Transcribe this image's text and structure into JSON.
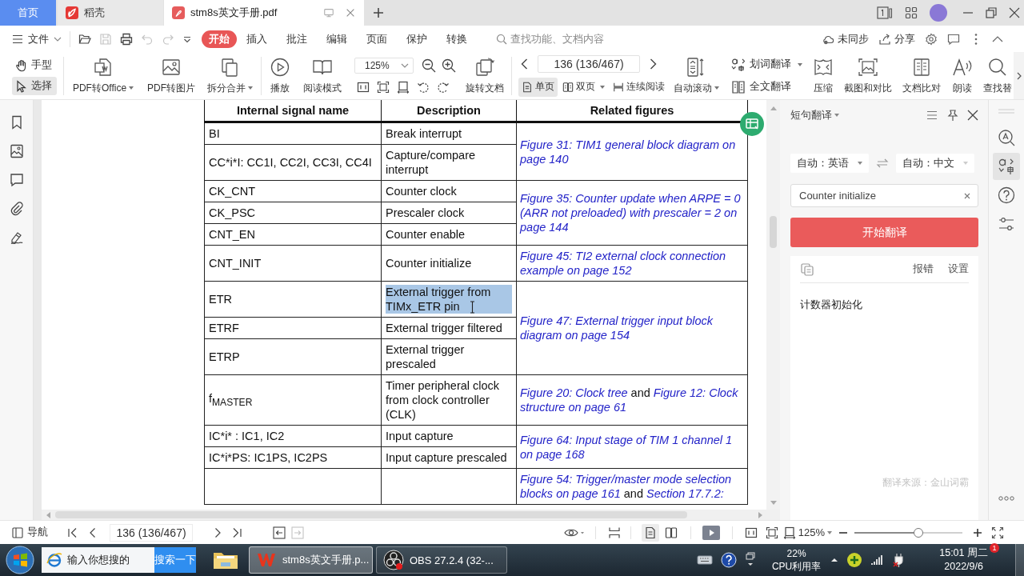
{
  "tabs": [
    {
      "kind": "home",
      "label": "首页",
      "selected": false
    },
    {
      "kind": "docer",
      "label": "稻壳",
      "selected": false
    },
    {
      "kind": "pdf",
      "label": "stm8s英文手册.pdf",
      "selected": true
    }
  ],
  "menu_bar": {
    "file_menu": "文件",
    "quick_access": [
      {
        "disabled": false
      },
      {
        "disabled": true
      },
      {
        "disabled": false
      },
      {
        "disabled": true
      },
      {
        "disabled": true
      }
    ],
    "items": [
      {
        "label": "开始",
        "selected": true
      },
      {
        "label": "插入",
        "selected": false
      },
      {
        "label": "批注",
        "selected": false
      },
      {
        "label": "编辑",
        "selected": false
      },
      {
        "label": "页面",
        "selected": false
      },
      {
        "label": "保护",
        "selected": false
      },
      {
        "label": "转换",
        "selected": false
      }
    ],
    "search": {
      "placeholder": "查找功能、文档内容"
    },
    "sync": "未同步",
    "share": "分享"
  },
  "toolbar": {
    "pointer_tools": [
      {
        "label": "手型",
        "selected": false
      },
      {
        "label": "选择",
        "selected": true
      }
    ],
    "actions": [
      {
        "label": "PDF转Office",
        "dropdown": true
      },
      {
        "label": "PDF转图片",
        "dropdown": false
      },
      {
        "label": "拆分合并",
        "dropdown": true
      },
      {
        "label": "播放",
        "dropdown": false
      },
      {
        "label": "阅读模式",
        "dropdown": false
      }
    ],
    "zoom": {
      "value": "125%"
    },
    "rotate": {
      "label": "旋转文档"
    },
    "page_field": {
      "value": "136 (136/467)"
    },
    "view_modes": [
      {
        "label": "单页",
        "selected": true,
        "dropdown": false
      },
      {
        "label": "双页",
        "selected": false,
        "dropdown": true
      },
      {
        "label": "连续阅读",
        "selected": false,
        "dropdown": false
      }
    ],
    "auto_scroll": {
      "label": "自动滚动",
      "dropdown": true
    },
    "translate": [
      {
        "label": "划词翻译",
        "dropdown": true
      },
      {
        "label": "全文翻译",
        "dropdown": false
      }
    ],
    "more_tools": [
      {
        "label": "压缩"
      },
      {
        "label": "截图和对比"
      },
      {
        "label": "文档比对"
      },
      {
        "label": "朗读"
      },
      {
        "label": "查找替"
      }
    ]
  },
  "document": {
    "table": {
      "columns": [
        "Internal signal name",
        "Description",
        "Related figures"
      ],
      "groups": [
        {
          "figure": {
            "kind": "link",
            "text": "Figure 31: TIM1 general block diagram on page 140"
          },
          "rows": [
            {
              "signal": "BI",
              "description": "Break interrupt",
              "highlighted": false
            },
            {
              "signal": "CC*i*I: CC1I, CC2I, CC3I, CC4I",
              "description": "Capture/compare interrupt",
              "highlighted": false
            }
          ]
        },
        {
          "figure": {
            "kind": "link",
            "text": "Figure 35: Counter update when ARPE = 0 (ARR not preloaded) with prescaler = 2 on page 144"
          },
          "rows": [
            {
              "signal": "CK_CNT",
              "description": "Counter clock",
              "highlighted": false
            },
            {
              "signal": "CK_PSC",
              "description": "Prescaler clock",
              "highlighted": false
            },
            {
              "signal": "CNT_EN",
              "description": "Counter enable",
              "highlighted": false
            }
          ]
        },
        {
          "figure": {
            "kind": "link",
            "text": "Figure 45: TI2 external clock connection example on page 152"
          },
          "rows": [
            {
              "signal": "CNT_INIT",
              "description": "Counter initialize",
              "highlighted": false
            }
          ]
        },
        {
          "figure": {
            "kind": "link",
            "text": "Figure 47: External trigger input block diagram on page 154"
          },
          "rows": [
            {
              "signal": "ETR",
              "description": "External trigger from TIMx_ETR pin",
              "highlighted": true
            },
            {
              "signal": "ETRF",
              "description": "External trigger filtered",
              "highlighted": false
            },
            {
              "signal": "ETRP",
              "description": "External trigger prescaled",
              "highlighted": false
            }
          ]
        },
        {
          "figure": {
            "kind": "mixed",
            "text": "*Figure 20: Clock tree* and *Figure 12: Clock structure on page 61*"
          },
          "rows": [
            {
              "signal": "f$_{MASTER}$",
              "description": "Timer peripheral clock from clock controller (CLK)",
              "highlighted": false
            }
          ]
        },
        {
          "figure": {
            "kind": "link",
            "text": "Figure 64: Input stage of TIM 1 channel 1 on page 168"
          },
          "rows": [
            {
              "signal": "IC*i* : IC1, IC2",
              "description": "Input capture",
              "highlighted": false
            },
            {
              "signal": "IC*i*PS: IC1PS, IC2PS",
              "description": "Input capture prescaled",
              "highlighted": false
            }
          ]
        },
        {
          "figure": {
            "kind": "mixed",
            "text": "*Figure 54: Trigger/master mode selection blocks on page 161* and *Section 17.7.2:*"
          },
          "rows": [
            {
              "highlighted": false
            }
          ]
        }
      ]
    }
  },
  "translate_panel": {
    "title": "短句翻译",
    "source_language": "自动：英语",
    "target_language": "自动：中文",
    "input": {
      "value": "Counter initialize"
    },
    "translate_button": "开始翻译",
    "result_actions": [
      "报错",
      "设置"
    ],
    "result": "计数器初始化",
    "source": "翻译来源：金山词霸"
  },
  "rail_tools": [
    {
      "selected": false
    },
    {
      "selected": true
    },
    {
      "selected": false
    },
    {
      "selected": false
    }
  ],
  "status_bar": {
    "nav": "导航",
    "page_field": {
      "value": "136 (136/467)"
    },
    "history": [
      {
        "disabled": false
      },
      {
        "disabled": true
      }
    ],
    "view_modes": [
      {
        "selected": true
      },
      {
        "selected": false
      }
    ],
    "zoom": "125%",
    "zoom_slider": {
      "level": 0.59
    }
  },
  "taskbar": {
    "search": {
      "placeholder": "输入你想搜的"
    },
    "search_button": "搜索一下",
    "tasks": [
      {
        "kind": "wps",
        "label": "stm8s英文手册.p...",
        "selected": true
      },
      {
        "kind": "obs",
        "label": "OBS 27.2.4 (32-...",
        "selected": false
      }
    ],
    "tray": {
      "cpu_percent": "22%",
      "cpu_label": "CPU利用率",
      "time": "15:01 周二",
      "date": "2022/9/6",
      "badge": "1"
    }
  }
}
